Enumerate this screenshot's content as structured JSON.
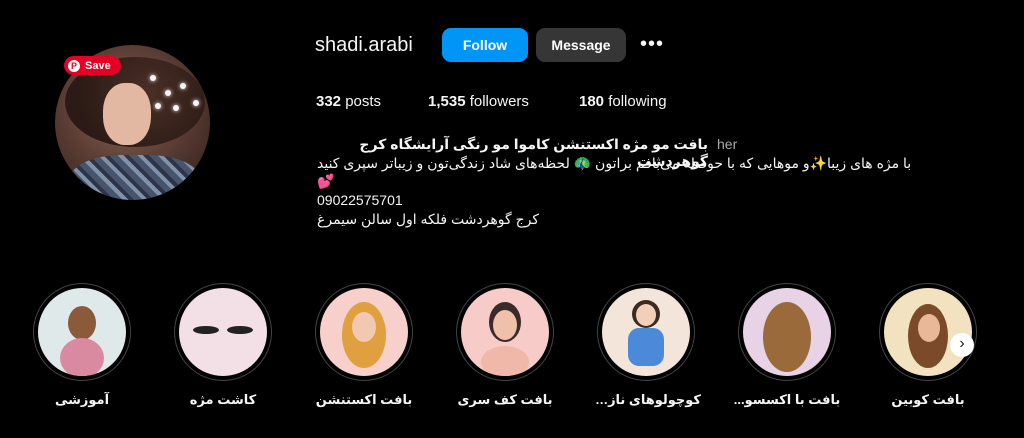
{
  "profile": {
    "username": "shadi.arabi",
    "follow_label": "Follow",
    "message_label": "Message",
    "more_label": "•••",
    "save_label": "Save",
    "pinterest_icon": "P"
  },
  "stats": {
    "posts_count": "332",
    "posts_label": "posts",
    "followers_count": "1,535",
    "followers_label": "followers",
    "following_count": "180",
    "following_label": "following"
  },
  "bio": {
    "name": "بافت مو مژه اکستنشن کاموا مو رنگی آرایشگاه کرج گوهردشت",
    "pronoun": "her",
    "line1": "با مژه های زیبا✨و موهایی که با حوصله می‌بافم براتون 🦚 لحظه‌های شاد زندگی‌تون و زیباتر سپری کنید",
    "heart": "💕",
    "phone": "09022575701",
    "address": "کرج گوهردشت فلکه اول سالن سیمرغ"
  },
  "highlights": [
    {
      "label": "آموزشی",
      "bg": "#dfe9ea"
    },
    {
      "label": "کاشت مژه",
      "bg": "#f3dfe6"
    },
    {
      "label": "بافت اکستنشن",
      "bg": "#f7cfcb"
    },
    {
      "label": "بافت کف سری",
      "bg": "#f6cbc8"
    },
    {
      "label": "کوچولوهای نازن...",
      "bg": "#f3e5da"
    },
    {
      "label": "بافت با اکسسو...",
      "bg": "#e8d3e6"
    },
    {
      "label": "بافت کوبین",
      "bg": "#f2e2bf"
    }
  ],
  "next_icon": "›"
}
